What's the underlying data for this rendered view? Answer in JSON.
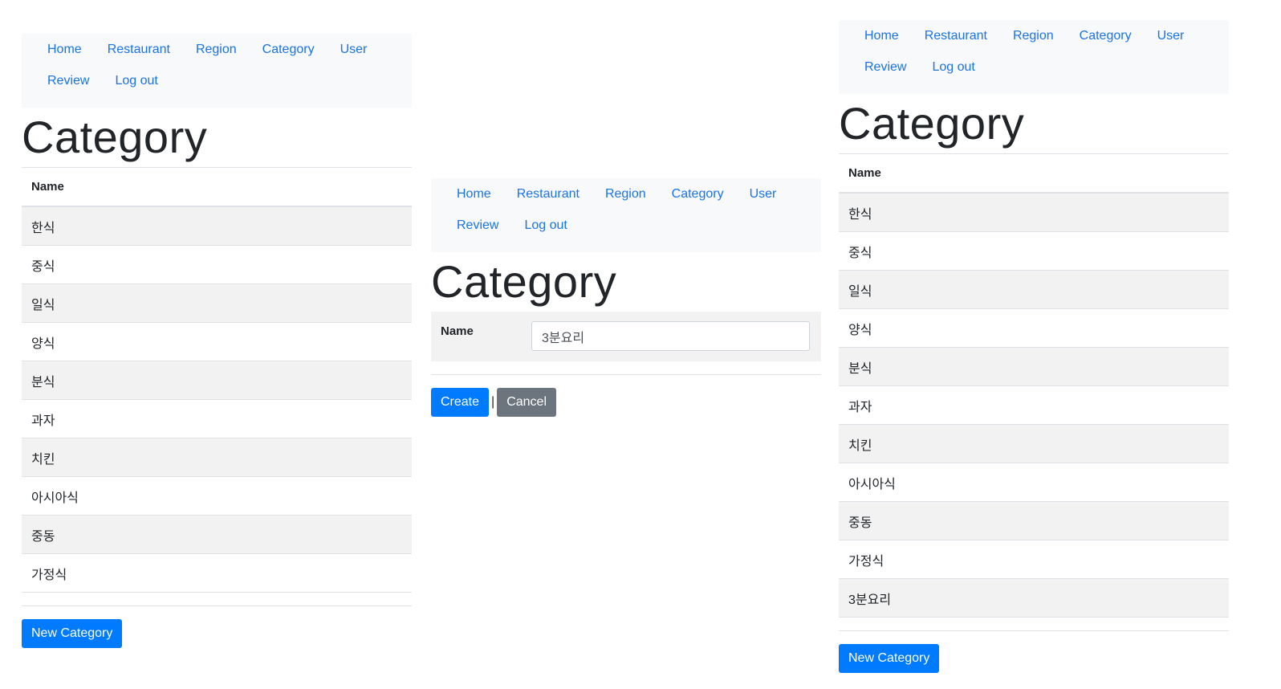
{
  "nav": {
    "home": "Home",
    "restaurant": "Restaurant",
    "region": "Region",
    "category": "Category",
    "user": "User",
    "review": "Review",
    "logout": "Log out"
  },
  "list_left": {
    "title": "Category",
    "column_header": "Name",
    "rows": [
      "한식",
      "중식",
      "일식",
      "양식",
      "분식",
      "과자",
      "치킨",
      "아시아식",
      "중동",
      "가정식"
    ],
    "new_button": "New Category"
  },
  "create_form": {
    "title": "Category",
    "name_label": "Name",
    "name_value": "3분요리",
    "create_button": "Create",
    "separator": "|",
    "cancel_button": "Cancel"
  },
  "list_right": {
    "title": "Category",
    "column_header": "Name",
    "rows": [
      "한식",
      "중식",
      "일식",
      "양식",
      "분식",
      "과자",
      "치킨",
      "아시아식",
      "중동",
      "가정식",
      "3분요리"
    ],
    "new_button": "New Category"
  },
  "colors": {
    "link": "#1a73e8",
    "primary": "#007bff",
    "secondary": "#6c757d",
    "navbar_bg": "#f8f9fa",
    "stripe": "#f2f2f2"
  }
}
